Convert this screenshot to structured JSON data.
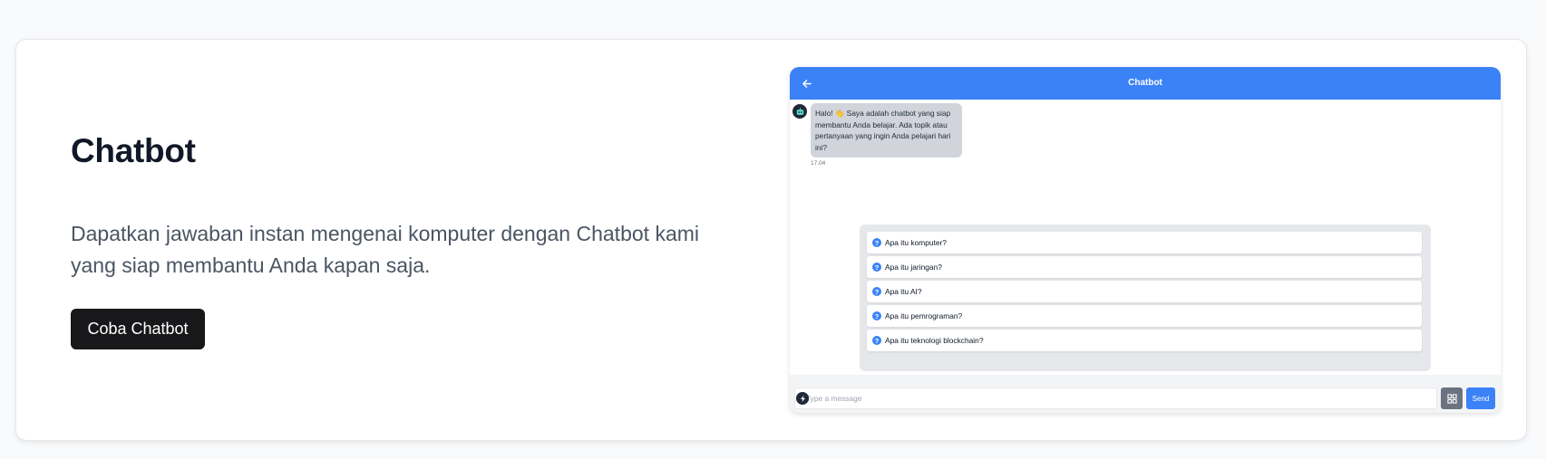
{
  "hero": {
    "title": "Chatbot",
    "description": "Dapatkan jawaban instan mengenai komputer dengan Chatbot kami yang siap membantu Anda kapan saja.",
    "cta_label": "Coba Chatbot"
  },
  "chat": {
    "header_title": "Chatbot",
    "back_icon": "arrow-left-icon",
    "bot_avatar_icon": "robot-icon",
    "messages": [
      {
        "sender": "bot",
        "text": "Halo! 👋 Saya adalah chatbot yang siap membantu Anda belajar. Ada topik atau pertanyaan yang ingin Anda pelajari hari ini?",
        "time": "17.04"
      }
    ],
    "suggestion_icon": "question-circle-icon",
    "suggestions": [
      "Apa itu komputer?",
      "Apa itu jaringan?",
      "Apa itu AI?",
      "Apa itu pemrograman?",
      "Apa itu teknologi blockchain?"
    ],
    "input_placeholder": "Type a message",
    "send_label": "Send",
    "attach_icon": "bolt-icon",
    "menu_icon": "grid-icon"
  },
  "colors": {
    "accent": "#3b82f6",
    "cta_bg": "#18181b",
    "bubble_bg": "#d1d5db",
    "page_bg": "#f9fafb"
  }
}
